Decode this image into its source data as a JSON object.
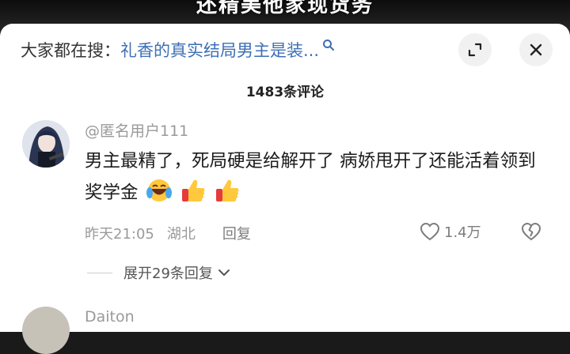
{
  "video": {
    "caption": "还精美他家现货务"
  },
  "search": {
    "prefix": "大家都在搜：",
    "query": "礼香的真实结局男主是装..."
  },
  "comments_count": "1483条评论",
  "comment": {
    "username": "@匿名用户111",
    "text": "男主最精了，死局硬是给解开了  病娇甩开了还能活着领到奖学金",
    "time": "昨天21:05",
    "location": "湖北",
    "reply_label": "回复",
    "likes": "1.4万",
    "expand_label": "展开29条回复"
  },
  "next_comment": {
    "username": "Daiton"
  },
  "colors": {
    "link_blue": "#3d6fb4",
    "panel_bg": "#ffffff",
    "meta_gray": "#9a9a9a"
  }
}
